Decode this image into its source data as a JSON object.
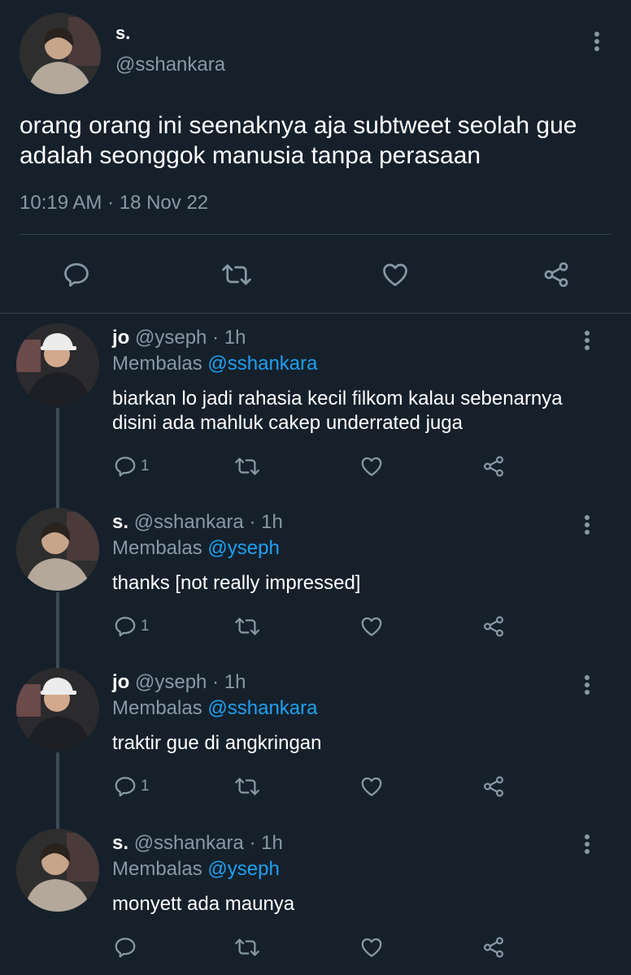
{
  "main_tweet": {
    "name": "s.",
    "handle": "@sshankara",
    "text": "orang orang ini seenaknya aja subtweet seolah gue adalah seonggok manusia tanpa perasaan",
    "timestamp": "10:19 AM · 18 Nov 22"
  },
  "replies": [
    {
      "name": "jo",
      "handle_time": "@yseph · 1h",
      "replying_prefix": "Membalas",
      "replying_to": "@sshankara",
      "text": "biarkan lo jadi rahasia kecil filkom kalau sebenarnya disini ada mahluk cakep underrated juga",
      "reply_count": "1"
    },
    {
      "name": "s.",
      "handle_time": "@sshankara · 1h",
      "replying_prefix": "Membalas",
      "replying_to": "@yseph",
      "text": "thanks [not really impressed]",
      "reply_count": "1"
    },
    {
      "name": "jo",
      "handle_time": "@yseph · 1h",
      "replying_prefix": "Membalas",
      "replying_to": "@sshankara",
      "text": "traktir gue di angkringan",
      "reply_count": "1"
    },
    {
      "name": "s.",
      "handle_time": "@sshankara · 1h",
      "replying_prefix": "Membalas",
      "replying_to": "@yseph",
      "text": "monyett ada maunya",
      "reply_count": ""
    }
  ],
  "theme": {
    "background": "#15202b",
    "secondary_text": "#8899a6",
    "mention": "#1da1f2",
    "divider": "#38444d"
  },
  "icons": [
    "reply-icon",
    "retweet-icon",
    "like-icon",
    "share-icon",
    "more-options-icon"
  ]
}
